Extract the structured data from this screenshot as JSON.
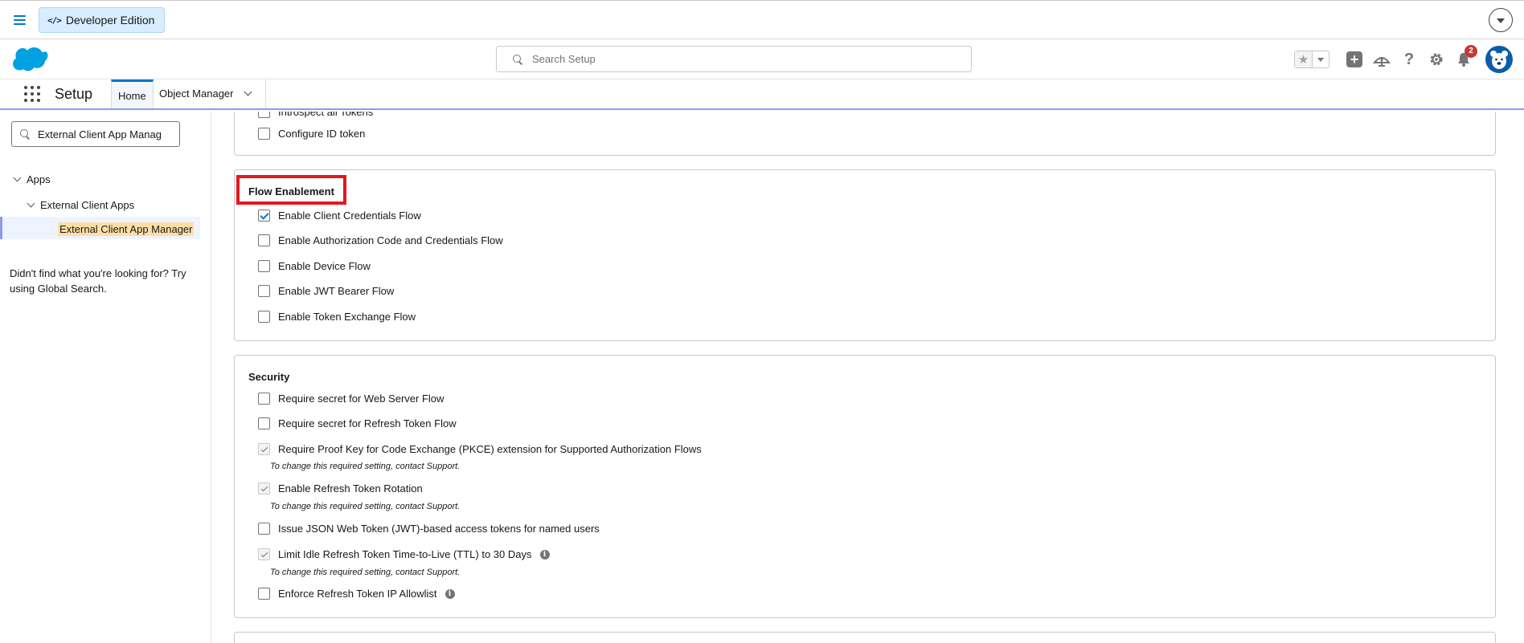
{
  "topbar": {
    "edition_label": "Developer Edition"
  },
  "header": {
    "search_placeholder": "Search Setup",
    "notifications_count": "2"
  },
  "nav": {
    "app_name": "Setup",
    "tabs": [
      {
        "label": "Home"
      },
      {
        "label": "Object Manager"
      }
    ]
  },
  "sidebar": {
    "search_value": "External Client App Manag",
    "tree": [
      {
        "label": "Apps"
      },
      {
        "label": "External Client Apps"
      },
      {
        "label": "External Client App Manager"
      }
    ],
    "help_text": "Didn't find what you're looking for? Try using Global Search."
  },
  "oauth_card": {
    "items": [
      {
        "label": "Introspect all Tokens",
        "checked": false
      },
      {
        "label": "Configure ID token",
        "checked": false
      }
    ]
  },
  "flow_card": {
    "title": "Flow Enablement",
    "items": [
      {
        "label": "Enable Client Credentials Flow",
        "checked": true
      },
      {
        "label": "Enable Authorization Code and Credentials Flow",
        "checked": false
      },
      {
        "label": "Enable Device Flow",
        "checked": false
      },
      {
        "label": "Enable JWT Bearer Flow",
        "checked": false
      },
      {
        "label": "Enable Token Exchange Flow",
        "checked": false
      }
    ]
  },
  "security_card": {
    "title": "Security",
    "items": [
      {
        "label": "Require secret for Web Server Flow",
        "checked": false
      },
      {
        "label": "Require secret for Refresh Token Flow",
        "checked": false
      },
      {
        "label": "Require Proof Key for Code Exchange (PKCE) extension for Supported Authorization Flows",
        "checked": true,
        "disabled": true,
        "note": "To change this required setting, contact Support."
      },
      {
        "label": "Enable Refresh Token Rotation",
        "checked": true,
        "disabled": true,
        "note": "To change this required setting, contact Support."
      },
      {
        "label": "Issue JSON Web Token (JWT)-based access tokens for named users",
        "checked": false
      },
      {
        "label": "Limit Idle Refresh Token Time-to-Live (TTL) to 30 Days",
        "checked": true,
        "disabled": true,
        "note": "To change this required setting, contact Support."
      },
      {
        "label": "Enforce Refresh Token IP Allowlist",
        "checked": false
      }
    ]
  },
  "colors": {
    "brand_blue": "#0176d3",
    "highlight_red": "#e5171d",
    "selected_label_bg": "#fddfa5"
  }
}
